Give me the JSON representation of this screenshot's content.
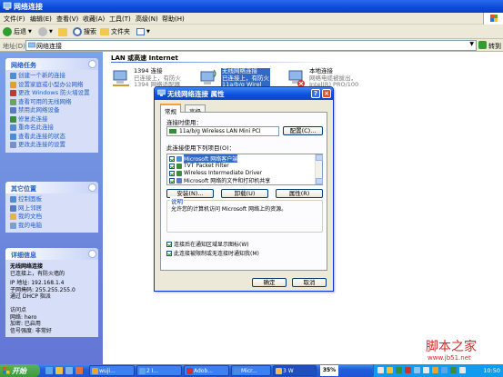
{
  "window": {
    "title": "网络连接"
  },
  "menu": {
    "items": [
      "文件(F)",
      "编辑(E)",
      "查看(V)",
      "收藏(A)",
      "工具(T)",
      "高级(N)",
      "帮助(H)"
    ]
  },
  "toolbar": {
    "back": "后退",
    "search": "搜索",
    "folders": "文件夹"
  },
  "address": {
    "label": "地址(D)",
    "value": "网络连接",
    "go": "转到"
  },
  "network_tasks": {
    "title": "网络任务",
    "items": [
      "创建一个新的连接",
      "设置家庭或小型办公网络",
      "更改 Windows 防火墙设置",
      "查看可用的无线网络",
      "禁用此网络设备",
      "修复此连接",
      "重命名此连接",
      "查看此连接的状态",
      "更改此连接的设置"
    ]
  },
  "other_places": {
    "title": "其它位置",
    "items": [
      "控制面板",
      "网上邻居",
      "我的文档",
      "我的电脑"
    ]
  },
  "details": {
    "title": "详细信息",
    "name": "无线网络连接",
    "status": "已连接上，有防火墙的",
    "lines": [
      "IP 地址: 192.168.1.4",
      "子网掩码: 255.255.255.0",
      "通过 DHCP 指派",
      "",
      "访问点",
      "网络: hero",
      "加密: 已启用",
      "信号强度: 非常好"
    ]
  },
  "content": {
    "group_header": "LAN 或高速 Internet",
    "connections": [
      {
        "name": "1394 连接",
        "status": "已连接上，有防火",
        "device": "1394 网络适配器"
      },
      {
        "name": "无线网络连接",
        "status": "已连接上，有防火",
        "device": "11a/b/g Wirel"
      },
      {
        "name": "本地连接",
        "status": "网络电缆被拔出，",
        "device": "Intel(R) PRO/100"
      }
    ]
  },
  "dialog": {
    "title": "无线网络连接 属性",
    "tabs": [
      "常规",
      "高级"
    ],
    "connect_using_label": "连接时使用：",
    "adapter": "11a/b/g Wireless LAN Mini PCI",
    "configure_button": "配置(C)...",
    "items_label": "此连接使用下列项目(O)：",
    "items": [
      "Microsoft 网络客户端",
      "TVT Packet Filter",
      "Wireless Intermediate Driver",
      "Microsoft 网络的文件和打印机共享"
    ],
    "install_button": "安装(N)...",
    "uninstall_button": "卸载(U)",
    "properties_button": "属性(R)",
    "description_header": "说明",
    "description_text": "允许您的计算机访问 Microsoft 网络上的资源。",
    "checkbox1": "连接后在通知区域显示图标(W)",
    "checkbox2": "此连接被限制或无连接时通知我(M)",
    "ok_button": "确定",
    "cancel_button": "取消"
  },
  "taskbar": {
    "start": "开始",
    "buttons": [
      "wuji...",
      "2 I...",
      "Adob...",
      "Micr...",
      "3 W"
    ],
    "lang": "35%",
    "clock": "10:50"
  },
  "watermark": {
    "brand": "脚本之家",
    "url": "www.jb51.net"
  }
}
